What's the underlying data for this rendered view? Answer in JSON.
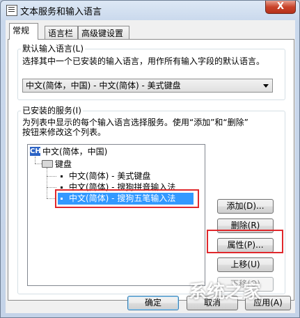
{
  "window": {
    "title": "文本服务和输入语言",
    "close_label": "X"
  },
  "tabs": [
    {
      "label": "常规"
    },
    {
      "label": "语言栏"
    },
    {
      "label": "高级键设置"
    }
  ],
  "default_language": {
    "group_label": "默认输入语言(L)",
    "description": "选择其中一个已安装的输入语言，用作所有输入字段的默认语言。",
    "selected": "中文(简体，中国) - 中文(简体) - 美式键盘"
  },
  "installed_services": {
    "group_label": "已安装的服务(I)",
    "description_line1": "为列表中显示的每个输入语言选择服务。使用“添加”和“删除”",
    "description_line2": "按钮来修改这个列表。",
    "language_badge": "CH",
    "language": "中文(简体，中国)",
    "category": "键盘",
    "items": [
      {
        "label": "中文(简体) - 美式键盘"
      },
      {
        "label": "中文(简体) - 搜狗拼音输入法"
      },
      {
        "label": "中文(简体) - 搜狗五笔输入法"
      }
    ]
  },
  "buttons": {
    "add": "添加(D)...",
    "remove": "删除(R)",
    "properties": "属性(P)...",
    "move_up": "上移(U)",
    "move_down": "下移(O)",
    "ok": "确定",
    "cancel": "取消",
    "apply": "应用(A)"
  },
  "watermark": "系统之家"
}
